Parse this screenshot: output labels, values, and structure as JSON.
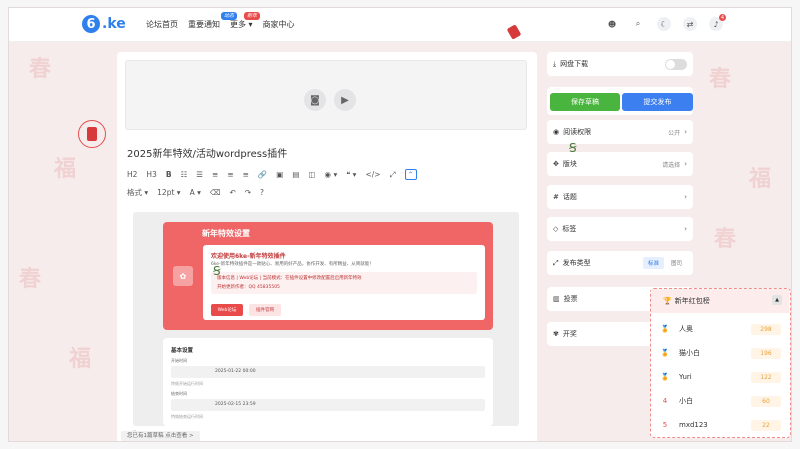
{
  "header": {
    "logo_text": ".ke",
    "nav": [
      {
        "label": "论坛首页"
      },
      {
        "label": "重要通知",
        "badge": "动态"
      },
      {
        "label": "更多",
        "badge": "新年"
      },
      {
        "label": "商家中心"
      }
    ],
    "notification_count": "4"
  },
  "editor": {
    "post_title": "2025新年特效/活动wordpress插件",
    "toolbar_row1": [
      "H2",
      "H3",
      "B",
      "☷",
      "☰",
      "≡",
      "≡",
      "≡",
      "🔗",
      "▣",
      "▤",
      "◫",
      "◉ ▾",
      "❝ ▾",
      "</>",
      "⤢",
      "⌃"
    ],
    "toolbar_row2": [
      "格式 ▾",
      "12pt ▾",
      "A ▾",
      "⌫",
      "↶",
      "↷",
      "?"
    ],
    "status_path": "p",
    "status_hint": "您已有1篇草稿 点击查看 >"
  },
  "preview": {
    "card_title": "新年特效设置",
    "welcome": "欢迎使用6ke-新年特效插件",
    "welcome_sub": "6ke-新年特效插件是一款贴心、易用的好产品，协作开发、有所精益、从简就能！",
    "info_line1": "版本信息 | Web论坛 | 当前模式：在插件设置中修改配置后启用新年特效",
    "info_line2": "开始更新作者：QQ 45835505",
    "button1": "Web论坛",
    "button2": "插件官网",
    "section_title": "基本设置",
    "field1_label": "开始时间",
    "field1_value": "2025-01-22 00:00",
    "field1_hint": "特效开始运行时间",
    "field2_label": "结束时间",
    "field2_value": "2025-02-15 23:59",
    "field2_hint": "特效结束运行时间"
  },
  "sidebar": {
    "download_label": "网盘下载",
    "save_label": "保存草稿",
    "publish_label": "提交发布",
    "permission_label": "阅读权限",
    "permission_value": "公开",
    "section_label": "版块",
    "section_value": "请选择",
    "topic_label": "话题",
    "tag_label": "标签",
    "type_label": "发布类型",
    "type_options": [
      "标准",
      "图司"
    ],
    "vote_label": "投票",
    "lottery_label": "开奖"
  },
  "redpacket": {
    "title": "新年红包榜",
    "rows": [
      {
        "rank": "🏅",
        "name": "人奥",
        "amount": "298"
      },
      {
        "rank": "🏅",
        "name": "猫小白",
        "amount": "196"
      },
      {
        "rank": "🏅",
        "name": "Yuri",
        "amount": "122"
      },
      {
        "rank": "4",
        "name": "小白",
        "amount": "60"
      },
      {
        "rank": "5",
        "name": "mxd123",
        "amount": "22"
      }
    ]
  },
  "colors": {
    "accent": "#2f80ed",
    "red": "#f06565",
    "green": "#4ab53e"
  }
}
